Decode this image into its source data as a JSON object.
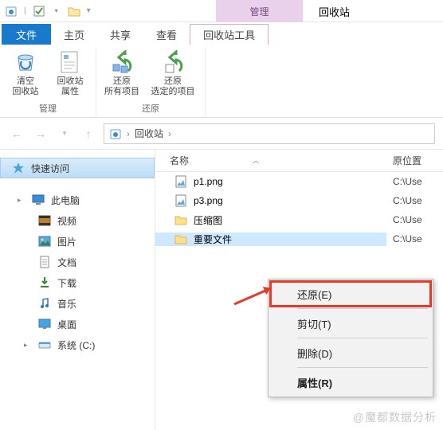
{
  "window": {
    "name": "回收站",
    "context_tab": "管理"
  },
  "tabs": {
    "file": "文件",
    "home": "主页",
    "share": "共享",
    "view": "查看",
    "tool": "回收站工具"
  },
  "ribbon": {
    "group_manage": "管理",
    "group_restore": "还原",
    "empty": "清空\n回收站",
    "props": "回收站\n属性",
    "restore_all": "还原\n所有项目",
    "restore_sel": "还原\n选定的项目"
  },
  "address": {
    "root": "回收站"
  },
  "nav": {
    "quick": "快速访问",
    "pc": "此电脑",
    "videos": "视频",
    "pictures": "图片",
    "documents": "文档",
    "downloads": "下载",
    "music": "音乐",
    "desktop": "桌面",
    "sysc": "系统 (C:)"
  },
  "columns": {
    "name": "名称",
    "loc": "原位置"
  },
  "files": [
    {
      "name": "p1.png",
      "loc": "C:\\Use",
      "type": "img"
    },
    {
      "name": "p3.png",
      "loc": "C:\\Use",
      "type": "img"
    },
    {
      "name": "压缩图",
      "loc": "C:\\Use",
      "type": "folder"
    },
    {
      "name": "重要文件",
      "loc": "C:\\Use",
      "type": "folder",
      "selected": true
    }
  ],
  "context_menu": {
    "restore": "还原(E)",
    "cut": "剪切(T)",
    "delete": "删除(D)",
    "properties": "属性(R)"
  },
  "watermark": "@魔都数据分析"
}
